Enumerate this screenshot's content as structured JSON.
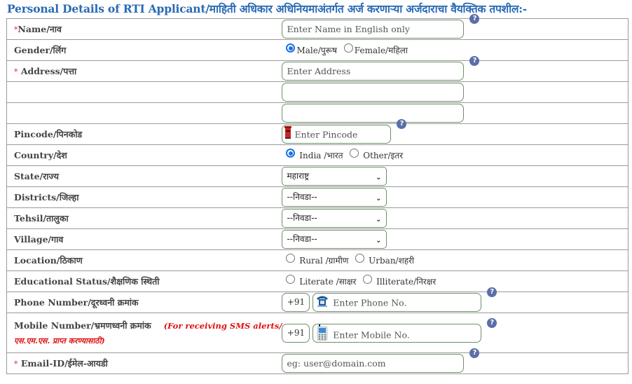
{
  "heading": "Personal Details of RTI Applicant/माहिती अधिकार अधिनियमाअंतर्गत अर्ज करणाऱ्या अर्जदाराचा वैयक्तिक तपशील:-",
  "required_mark": "*",
  "help_glyph": "?",
  "fields": {
    "name": {
      "label": "Name/नाव",
      "placeholder": "Enter Name in English only",
      "help_icon": "help-icon"
    },
    "gender": {
      "label": "Gender/लिंग",
      "options": [
        "Male/पुरूष",
        "Female/महिला"
      ],
      "selected": "Male/पुरूष"
    },
    "address": {
      "label": "Address/पत्ता",
      "placeholder": "Enter Address",
      "line2": "",
      "line3": ""
    },
    "pincode": {
      "label": "Pincode/पिनकोड",
      "placeholder": "Enter Pincode",
      "icon": "postbox-icon"
    },
    "country": {
      "label": "Country/देश",
      "options": [
        "India /भारत",
        "Other/इतर"
      ],
      "selected": "India /भारत"
    },
    "state": {
      "label": "State/राज्य",
      "selected": "महाराष्ट्र"
    },
    "district": {
      "label": "Districts/जिल्हा",
      "selected": "--निवडा--"
    },
    "tehsil": {
      "label": "Tehsil/तालुका",
      "selected": "--निवडा--"
    },
    "village": {
      "label": "Village/गाव",
      "selected": "--निवडा--"
    },
    "location": {
      "label": "Location/ठिकाण",
      "options": [
        "Rural /ग्रामीण",
        "Urban/शहरी"
      ],
      "selected": null
    },
    "education": {
      "label": "Educational Status/शैक्षणिक स्थिती",
      "options": [
        "Literate /साक्षर",
        "Illiterate/निरक्षर"
      ],
      "selected": null
    },
    "phone": {
      "label": "Phone Number/दूरध्वनी क्रमांक",
      "country_code": "+91",
      "placeholder": "Enter Phone No.",
      "icon": "telephone-icon"
    },
    "mobile": {
      "label": "Mobile Number/भ्रमणध्वनी क्रमांक",
      "note_line1": "(For receiving SMS alerts/",
      "note_line2": "एस.एम.एस. प्राप्त करण्यासाठी)",
      "country_code": "+91",
      "placeholder": "Enter Mobile No.",
      "icon": "mobile-phone-icon"
    },
    "email": {
      "label": "Email-ID/ईमेल-आयडी",
      "placeholder": "eg: user@domain.com"
    }
  }
}
